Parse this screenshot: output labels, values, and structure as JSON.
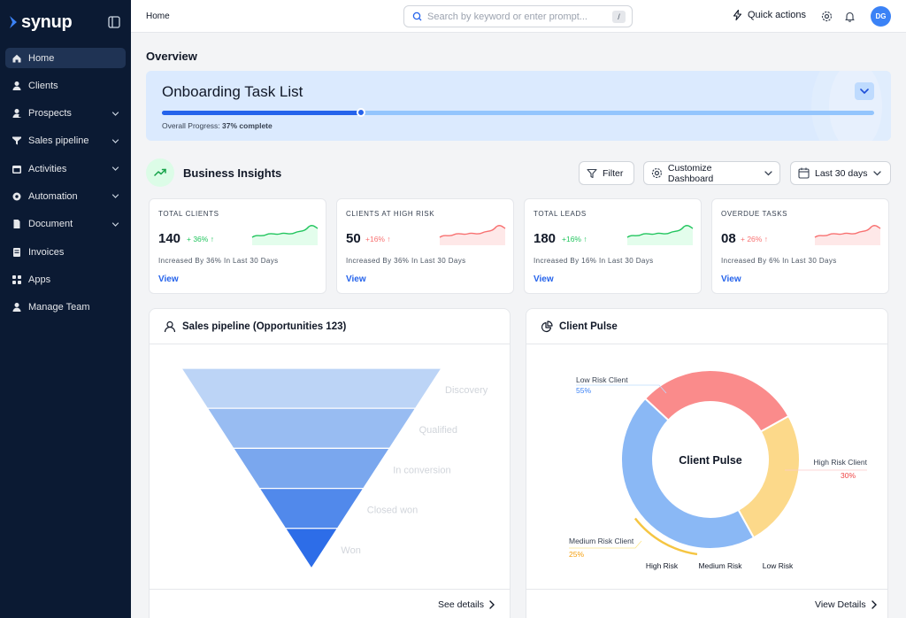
{
  "app": {
    "brand": "synup",
    "breadcrumb": "Home"
  },
  "sidebar": {
    "items": [
      {
        "label": "Home",
        "icon": "home-icon",
        "active": true,
        "expandable": false
      },
      {
        "label": "Clients",
        "icon": "user-icon",
        "active": false,
        "expandable": false
      },
      {
        "label": "Prospects",
        "icon": "prospects-icon",
        "active": false,
        "expandable": true
      },
      {
        "label": "Sales pipeline",
        "icon": "funnel-icon",
        "active": false,
        "expandable": true
      },
      {
        "label": "Activities",
        "icon": "calendar-icon",
        "active": false,
        "expandable": true
      },
      {
        "label": "Automation",
        "icon": "gear-icon",
        "active": false,
        "expandable": true
      },
      {
        "label": "Document",
        "icon": "document-icon",
        "active": false,
        "expandable": true
      },
      {
        "label": "Invoices",
        "icon": "invoice-icon",
        "active": false,
        "expandable": false
      },
      {
        "label": "Apps",
        "icon": "apps-icon",
        "active": false,
        "expandable": false
      },
      {
        "label": "Manage Team",
        "icon": "team-icon",
        "active": false,
        "expandable": false
      }
    ]
  },
  "topbar": {
    "search_placeholder": "Search by keyword or enter prompt...",
    "search_shortcut": "/",
    "quick_actions": "Quick actions",
    "avatar_initials": "DG"
  },
  "overview": {
    "title": "Overview",
    "onboarding": {
      "title": "Onboarding Task List",
      "progress_label": "Overall Progress:",
      "progress_text": "37% complete",
      "progress": 0.28
    }
  },
  "insights": {
    "title": "Business Insights",
    "filter_label": "Filter",
    "customize_label": "Customize Dashboard",
    "range_label": "Last 30 days",
    "cards": [
      {
        "label": "TOTAL CLIENTS",
        "value": "140",
        "change": "+ 36% ↑",
        "trend": "up",
        "desc": "Increased By 36% In Last 30 Days",
        "link": "View"
      },
      {
        "label": "CLIENTS AT HIGH RISK",
        "value": "50",
        "change": "+16% ↑",
        "trend": "down",
        "desc": "Increased By 36% In Last 30 Days",
        "link": "View"
      },
      {
        "label": "TOTAL LEADS",
        "value": "180",
        "change": "+16% ↑",
        "trend": "up",
        "desc": "Increased By 16% In Last 30 Days",
        "link": "View"
      },
      {
        "label": "OVERDUE TASKS",
        "value": "08",
        "change": "+ 26% ↑",
        "trend": "down",
        "desc": "Increased By 6% In Last 30 Days",
        "link": "View"
      }
    ]
  },
  "pipeline": {
    "title": "Sales pipeline (Opportunities 123)",
    "stages": [
      "Discovery",
      "Qualified",
      "In conversion",
      "Closed won",
      "Won"
    ],
    "stage_colors": [
      "#bcd4f6",
      "#98bcf2",
      "#7aa7ee",
      "#5189eb",
      "#2d6de8"
    ],
    "footer_link": "See details"
  },
  "pulse": {
    "title": "Client Pulse",
    "center_label": "Client Pulse",
    "segments": [
      {
        "name": "Low Risk Client",
        "pct": "55%",
        "value": 45,
        "color": "#8ab8f5",
        "pct_color": "#3b82f6"
      },
      {
        "name": "High Risk Client",
        "pct": "30%",
        "value": 30,
        "color": "#fa8b8b",
        "pct_color": "#ef4444"
      },
      {
        "name": "Medium Risk Client",
        "pct": "25%",
        "value": 25,
        "color": "#fcd98a",
        "pct_color": "#f59e0b"
      }
    ],
    "legend": [
      "High Risk",
      "Medium Risk",
      "Low Risk"
    ],
    "footer_link": "View Details"
  }
}
